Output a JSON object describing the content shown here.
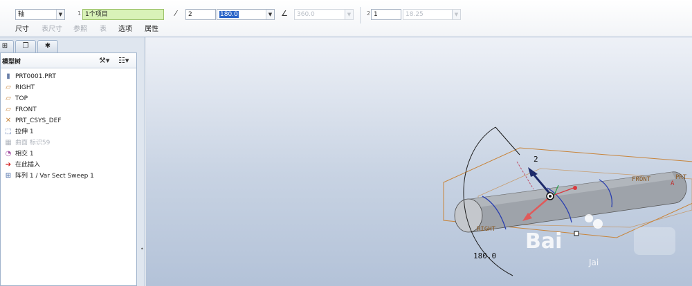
{
  "dashboard": {
    "reference_type": "轴",
    "reference_index": "1",
    "reference_value": "1个项目",
    "dim_value_a": "2",
    "dim_value_b": "180.0",
    "angle_value": "360.0",
    "pattern_index": "2",
    "pattern_count": "1",
    "pattern_spacing": "18.25",
    "tabs": [
      "尺寸",
      "表尺寸",
      "参照",
      "表",
      "选项",
      "属性"
    ]
  },
  "navigator": {
    "title": "模型树",
    "items": [
      {
        "label": "PRT0001.PRT",
        "icon": "part-icon"
      },
      {
        "label": "RIGHT",
        "icon": "datum-plane-icon"
      },
      {
        "label": "TOP",
        "icon": "datum-plane-icon"
      },
      {
        "label": "FRONT",
        "icon": "datum-plane-icon"
      },
      {
        "label": "PRT_CSYS_DEF",
        "icon": "csys-icon"
      },
      {
        "label": "拉伸 1",
        "icon": "extrude-icon"
      },
      {
        "label": "曲面 标识59",
        "icon": "surface-icon"
      },
      {
        "label": "相交 1",
        "icon": "intersect-icon"
      },
      {
        "label": "在此插入",
        "icon": "insert-here-icon"
      },
      {
        "label": "阵列 1 / Var Sect Sweep 1",
        "icon": "pattern-icon"
      }
    ]
  },
  "graphics": {
    "dim_radius_label": "2",
    "dim_angle_label": "180.0",
    "plane_front": "FRONT",
    "plane_right": "RIGHT",
    "plane_prt": "PRT",
    "plane_a": "A",
    "watermark": "Bai",
    "watermark_sub": "Jai"
  },
  "colors": {
    "field_active": "#d9f2b8",
    "datum_plane": "#c8843a",
    "dimension": "#1a1a1a",
    "drag_arrow": "#1e2b6b",
    "sweep_curve": "#2a3fb0"
  }
}
